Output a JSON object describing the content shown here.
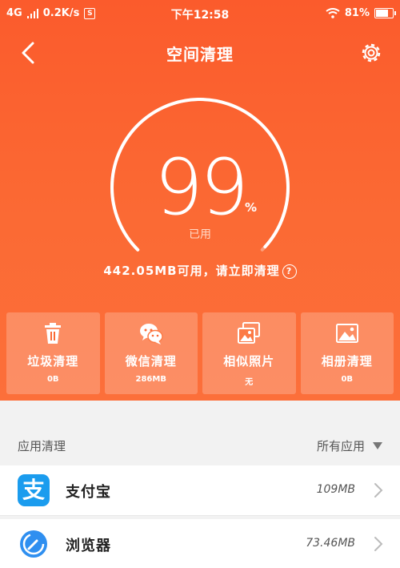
{
  "status": {
    "network": "4G",
    "speed": "0.2K/s",
    "badge": "S",
    "time": "下午12:58",
    "battery": "81%"
  },
  "header": {
    "title": "空间清理"
  },
  "gauge": {
    "value": "99",
    "unit": "%",
    "label": "已用",
    "fraction": 0.99
  },
  "summary": {
    "text": "442.05MB可用，请立即清理",
    "help": "?"
  },
  "cards": [
    {
      "label": "垃圾清理",
      "value": "0B",
      "icon": "trash-icon"
    },
    {
      "label": "微信清理",
      "value": "286MB",
      "icon": "wechat-icon"
    },
    {
      "label": "相似照片",
      "value": "无",
      "icon": "similar-photos-icon"
    },
    {
      "label": "相册清理",
      "value": "0B",
      "icon": "album-icon"
    }
  ],
  "apps_section": {
    "title": "应用清理",
    "filter": "所有应用"
  },
  "apps": [
    {
      "name": "支付宝",
      "size": "109MB",
      "icon": "alipay-icon",
      "icon_glyph": "支",
      "color": "#1b9cee"
    },
    {
      "name": "浏览器",
      "size": "73.46MB",
      "icon": "browser-icon",
      "color": "#2f8ff0"
    }
  ],
  "colors": {
    "hero": "#fb5b2c",
    "card": "rgba(255,255,255,0.22)",
    "text_dark": "#222222"
  }
}
